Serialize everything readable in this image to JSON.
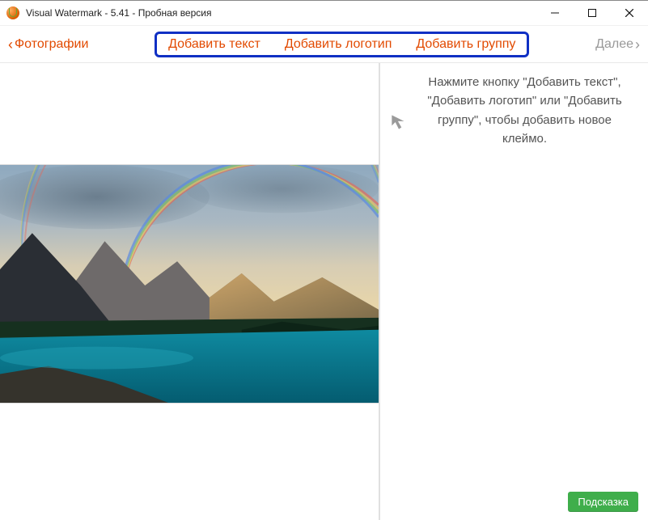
{
  "window": {
    "title": "Visual Watermark - 5.41 - Пробная версия"
  },
  "toolbar": {
    "back_label": "Фотографии",
    "add_text": "Добавить текст",
    "add_logo": "Добавить логотип",
    "add_group": "Добавить группу",
    "next_label": "Далее"
  },
  "sidebar": {
    "hint_text": "Нажмите кнопку \"Добавить текст\", \"Добавить логотип\" или \"Добавить группу\", чтобы добавить новое клеймо.",
    "tip_button": "Подсказка"
  }
}
